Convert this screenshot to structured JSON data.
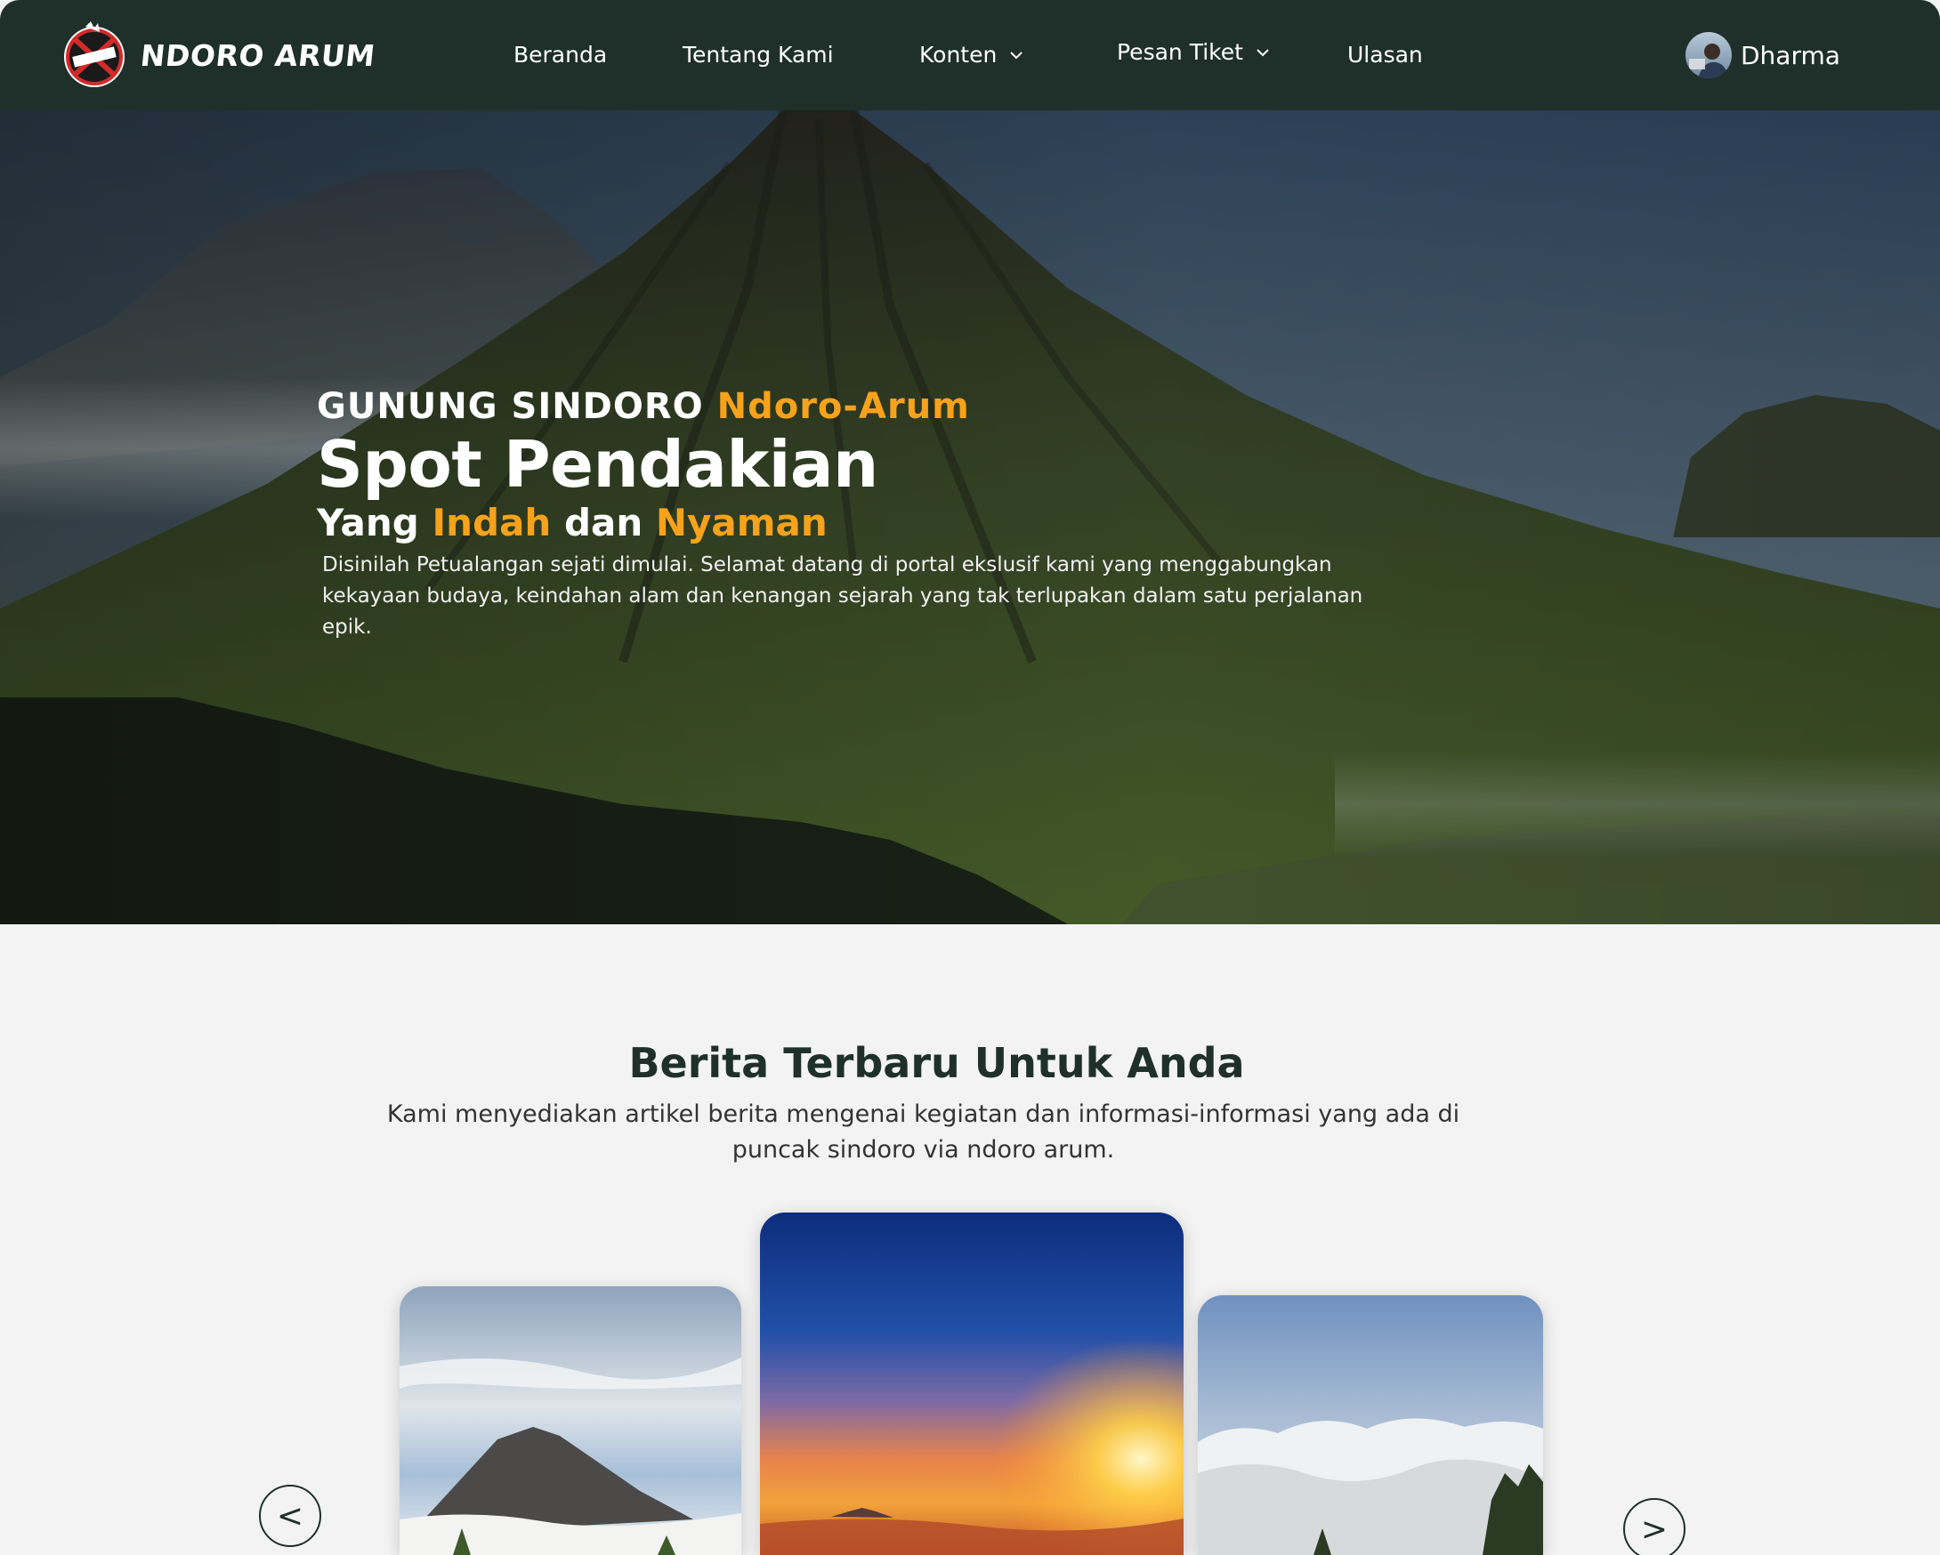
{
  "brand": {
    "name": "NDORO ARUM",
    "logo_text": "NDORO ARUM",
    "logo_icon": "ndoro-arum-emblem-logo"
  },
  "nav": {
    "items": [
      {
        "label": "Beranda",
        "has_dropdown": false
      },
      {
        "label": "Tentang Kami",
        "has_dropdown": false
      },
      {
        "label": "Konten",
        "has_dropdown": true
      },
      {
        "label": "Pesan Tiket",
        "has_dropdown": true
      },
      {
        "label": "Ulasan",
        "has_dropdown": false
      }
    ],
    "dropdown_icon": "chevron-down-icon"
  },
  "user": {
    "name": "Dharma",
    "avatar_icon": "user-avatar"
  },
  "hero": {
    "eyebrow_prefix": "GUNUNG SINDORO ",
    "eyebrow_accent": "Ndoro-Arum",
    "title": "Spot Pendakian",
    "subtitle_parts": [
      "Yang ",
      "Indah",
      " dan ",
      "Nyaman"
    ],
    "description": "Disinilah Petualangan sejati dimulai. Selamat datang di portal ekslusif kami yang menggabungkan kekayaan budaya, keindahan alam dan kenangan sejarah yang tak terlupakan dalam satu perjalanan epik."
  },
  "news": {
    "title": "Berita Terbaru Untuk Anda",
    "description": "Kami menyediakan  artikel berita mengenai kegiatan dan informasi-informasi yang ada di puncak sindoro via ndoro arum.",
    "prev_label": "<",
    "next_label": ">"
  },
  "colors": {
    "navbar": "#1f302b",
    "accent": "#f7a21b",
    "page_bg": "#f3f3f3",
    "heading": "#1f302b"
  }
}
